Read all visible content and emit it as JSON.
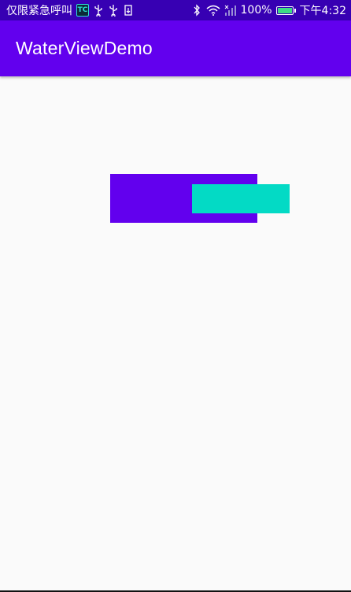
{
  "status_bar": {
    "carrier": "仅限紧急呼叫",
    "app_badge": "TC",
    "icons": [
      "usb-icon",
      "usb-icon",
      "download-icon",
      "bluetooth-icon",
      "wifi-icon",
      "signal-icon"
    ],
    "battery_level": 1.0,
    "battery_text": "100%",
    "time": "下午4:32",
    "background": "#3700b3"
  },
  "app_bar": {
    "title": "WaterViewDemo",
    "background": "#6200ee"
  },
  "water_view": {
    "bar_color": "#6200ee",
    "wave_color": "#03dac5"
  },
  "page": {
    "background": "#fafafa"
  }
}
